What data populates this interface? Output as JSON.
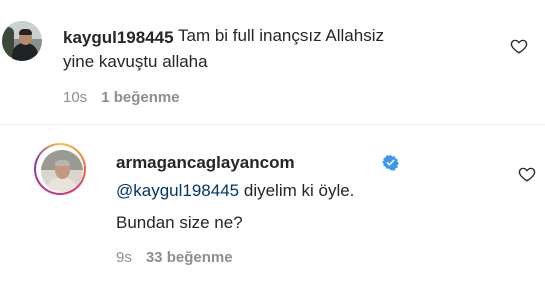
{
  "comments": [
    {
      "username": "kaygul198445",
      "text_line1": "Tam bi full inançsız Allahsiz",
      "text_line2": "yine kavuştu allaha",
      "time": "10s",
      "likes": "1 beğenme"
    },
    {
      "username": "armagancaglayancom",
      "mention": "@kaygul198445",
      "text_line1_rest": " diyelim ki öyle.",
      "text_line2": "Bundan size ne?",
      "time": "9s",
      "likes": "33 beğenme"
    }
  ],
  "icons": {
    "like": "heart-outline-icon",
    "verified": "verified-badge-icon"
  },
  "colors": {
    "text": "#262626",
    "meta": "#8e8e8e",
    "mention": "#00376b",
    "verified": "#3897f0"
  }
}
